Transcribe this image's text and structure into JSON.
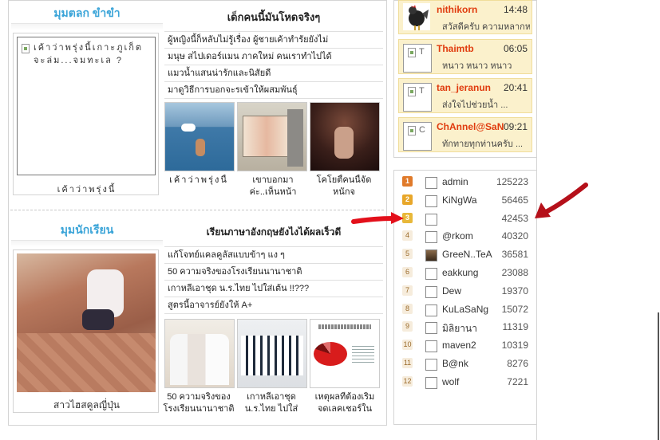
{
  "colors": {
    "accent_blue": "#3aa4d8",
    "chat_name": "#e03b0e",
    "chat_bg": "#fbf1cc",
    "arrow_red": "#e3101b"
  },
  "jokes": {
    "title": "มุมตลก ขำขำ",
    "box_text": "เค้าว่าพรุ่งนี้เกาะภูเก็ตจะล่ม...จมทะเล ?",
    "box_caption": "เค้าว่าพรุ่งนี้",
    "headline": "เด็กคนนี้มันโหดจริงๆ",
    "links": [
      "ผู้หญิงนี้ก็หลับไม่รู้เรื่อง ผู้ชายเค้าทำรัยยังไม่",
      "มนุษ สไปเดอร์แมน ภาคใหม่ คนเราทำไปได้",
      "แมวน้ำแสนน่ารักและนิสัยดี",
      "มาดูวิธีการบอกจะรเข้าให้ผสมพันธุ์"
    ],
    "thumbs": [
      {
        "caption": "เค้าว่าพรุ่งนี้"
      },
      {
        "caption": "เขาบอกมา ค่ะ..เห็นหน้า"
      },
      {
        "caption": "โคโยตี้คนนี้จัด หนักจ"
      }
    ]
  },
  "students": {
    "title": "มุมนักเรียน",
    "box_caption": "สาวไฮสคูลญี่ปุ่น",
    "headline": "เรียนภาษาอังกฤษยังไงได้ผลเร็วดี",
    "links": [
      "แก้โจทย์แคลคูลัสแบบข้าๆ แง ๆ",
      "50 ความจริงของโรงเรียนนานาชาติ",
      "เกาหลีเอาชุด น.ร.ไทย ไปใส่เต้น !!???",
      "สูตรนี้อาจารย์ยังให้ A+"
    ],
    "thumbs": [
      {
        "caption": "50 ความจริงของ โรงเรียนนานาชาติ"
      },
      {
        "caption": "เกาหลีเอาชุด น.ร.ไทย ไปใส่"
      },
      {
        "caption": "เหตุผลที่ต้องเริ่ม จดเลคเชอร์ใน"
      }
    ]
  },
  "chat": [
    {
      "name": "nithikorn",
      "time": "14:48",
      "msg": "สวัสดีครับ ความหลากห"
    },
    {
      "name": "Thaimtb",
      "time": "06:05",
      "msg": "หนาว หนาว หนาว",
      "avatar_letter": "T"
    },
    {
      "name": "tan_jeranun",
      "time": "20:41",
      "msg": "ส่งใจไปช่วยน้ำ ...",
      "avatar_letter": "T"
    },
    {
      "name": "ChAnnel@SaN",
      "time": "09:21",
      "msg": "ทักทายทุกท่านครับ ...",
      "avatar_letter": "C"
    }
  ],
  "ranking": [
    {
      "rank": "1",
      "name": "admin",
      "score": "125223"
    },
    {
      "rank": "2",
      "name": "KiNgWa",
      "score": "56465"
    },
    {
      "rank": "3",
      "name": "",
      "score": "42453"
    },
    {
      "rank": "4",
      "name": "@rkom",
      "score": "40320"
    },
    {
      "rank": "5",
      "name": "GreeN..TeA",
      "score": "36581"
    },
    {
      "rank": "6",
      "name": "eakkung",
      "score": "23088"
    },
    {
      "rank": "7",
      "name": "Dew",
      "score": "19370"
    },
    {
      "rank": "8",
      "name": "KuLaSaNg",
      "score": "15072"
    },
    {
      "rank": "9",
      "name": "มิลิยานา",
      "score": "11319"
    },
    {
      "rank": "10",
      "name": "maven2",
      "score": "10319"
    },
    {
      "rank": "11",
      "name": "B@nk",
      "score": "8276"
    },
    {
      "rank": "12",
      "name": "wolf",
      "score": "7221"
    }
  ]
}
